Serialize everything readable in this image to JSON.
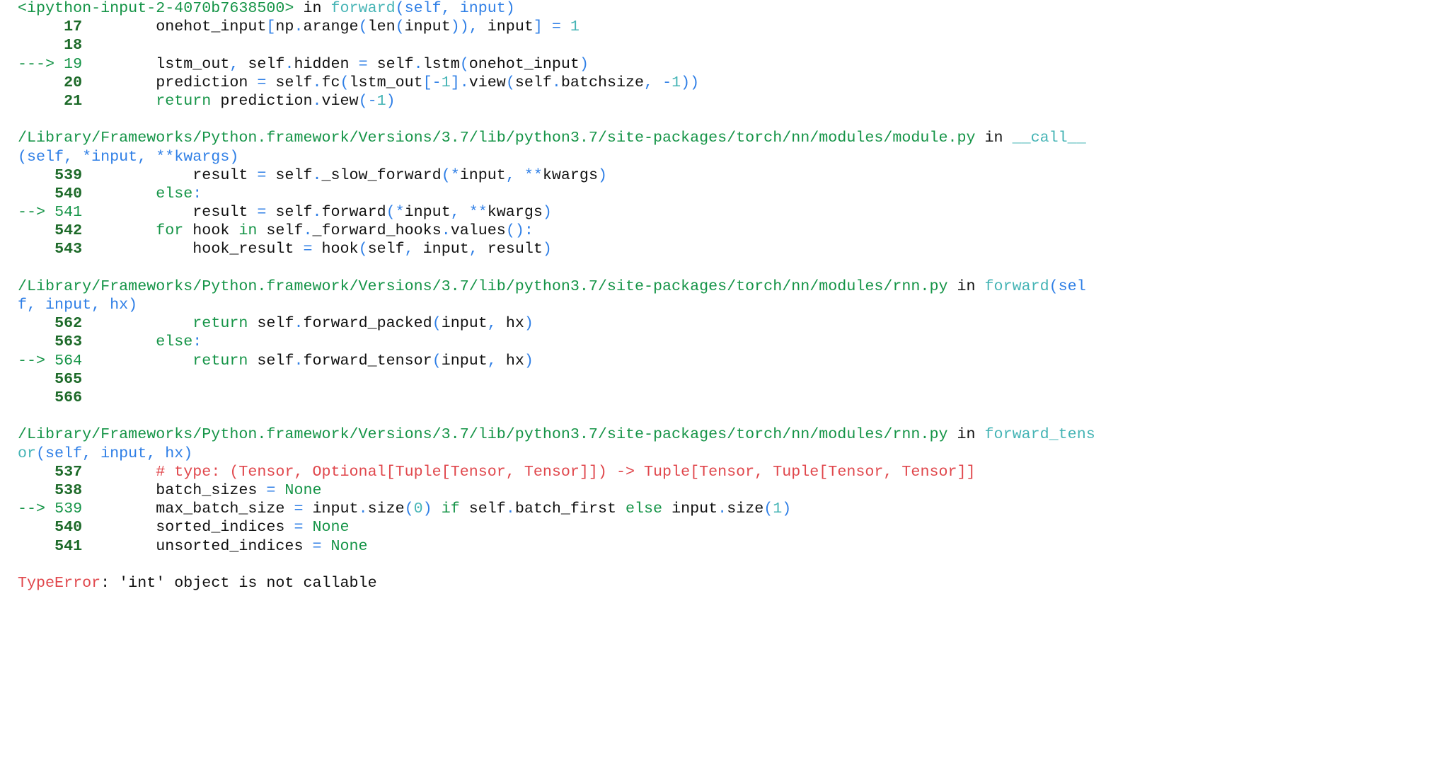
{
  "traceback": {
    "frames": [
      {
        "header": [
          {
            "t": "<ipython-input-2-4070b7638500>",
            "c": "g"
          },
          {
            "t": " in ",
            "c": "k"
          },
          {
            "t": "forward",
            "c": "c"
          },
          {
            "t": "(self, input)",
            "c": "b"
          }
        ],
        "lines": [
          {
            "marker": "",
            "lineno": "17",
            "current": false,
            "tokens": [
              {
                "t": "        onehot_input",
                "c": "k"
              },
              {
                "t": "[",
                "c": "b"
              },
              {
                "t": "np",
                "c": "k"
              },
              {
                "t": ".",
                "c": "b"
              },
              {
                "t": "arange",
                "c": "k"
              },
              {
                "t": "(",
                "c": "b"
              },
              {
                "t": "len",
                "c": "k"
              },
              {
                "t": "(",
                "c": "b"
              },
              {
                "t": "input",
                "c": "k"
              },
              {
                "t": "))",
                "c": "b"
              },
              {
                "t": ",",
                "c": "b"
              },
              {
                "t": " input",
                "c": "k"
              },
              {
                "t": "]",
                "c": "b"
              },
              {
                "t": " = ",
                "c": "b"
              },
              {
                "t": "1",
                "c": "c"
              }
            ]
          },
          {
            "marker": "",
            "lineno": "18",
            "current": false,
            "tokens": []
          },
          {
            "marker": "--->",
            "lineno": "19",
            "current": true,
            "tokens": [
              {
                "t": "        lstm_out",
                "c": "k"
              },
              {
                "t": ",",
                "c": "b"
              },
              {
                "t": " self",
                "c": "k"
              },
              {
                "t": ".",
                "c": "b"
              },
              {
                "t": "hidden ",
                "c": "k"
              },
              {
                "t": "=",
                "c": "b"
              },
              {
                "t": " self",
                "c": "k"
              },
              {
                "t": ".",
                "c": "b"
              },
              {
                "t": "lstm",
                "c": "k"
              },
              {
                "t": "(",
                "c": "b"
              },
              {
                "t": "onehot_input",
                "c": "k"
              },
              {
                "t": ")",
                "c": "b"
              }
            ]
          },
          {
            "marker": "",
            "lineno": "20",
            "current": false,
            "tokens": [
              {
                "t": "        prediction ",
                "c": "k"
              },
              {
                "t": "=",
                "c": "b"
              },
              {
                "t": " self",
                "c": "k"
              },
              {
                "t": ".",
                "c": "b"
              },
              {
                "t": "fc",
                "c": "k"
              },
              {
                "t": "(",
                "c": "b"
              },
              {
                "t": "lstm_out",
                "c": "k"
              },
              {
                "t": "[-",
                "c": "b"
              },
              {
                "t": "1",
                "c": "c"
              },
              {
                "t": "]",
                "c": "b"
              },
              {
                "t": ".",
                "c": "b"
              },
              {
                "t": "view",
                "c": "k"
              },
              {
                "t": "(",
                "c": "b"
              },
              {
                "t": "self",
                "c": "k"
              },
              {
                "t": ".",
                "c": "b"
              },
              {
                "t": "batchsize",
                "c": "k"
              },
              {
                "t": ", -",
                "c": "b"
              },
              {
                "t": "1",
                "c": "c"
              },
              {
                "t": "))",
                "c": "b"
              }
            ]
          },
          {
            "marker": "",
            "lineno": "21",
            "current": false,
            "tokens": [
              {
                "t": "        ",
                "c": "k"
              },
              {
                "t": "return",
                "c": "g"
              },
              {
                "t": " prediction",
                "c": "k"
              },
              {
                "t": ".",
                "c": "b"
              },
              {
                "t": "view",
                "c": "k"
              },
              {
                "t": "(-",
                "c": "b"
              },
              {
                "t": "1",
                "c": "c"
              },
              {
                "t": ")",
                "c": "b"
              }
            ]
          }
        ]
      },
      {
        "header": [
          {
            "t": "/Library/Frameworks/Python.framework/Versions/3.7/lib/python3.7/site-packages/torch/nn/modules/module.py",
            "c": "g"
          },
          {
            "t": " in ",
            "c": "k"
          },
          {
            "t": "__call__",
            "c": "c"
          },
          {
            "t": "\n(self, *input, **kwargs)",
            "c": "b"
          }
        ],
        "lines": [
          {
            "marker": "",
            "lineno": "539",
            "current": false,
            "tokens": [
              {
                "t": "            result ",
                "c": "k"
              },
              {
                "t": "=",
                "c": "b"
              },
              {
                "t": " self",
                "c": "k"
              },
              {
                "t": ".",
                "c": "b"
              },
              {
                "t": "_slow_forward",
                "c": "k"
              },
              {
                "t": "(*",
                "c": "b"
              },
              {
                "t": "input",
                "c": "k"
              },
              {
                "t": ", **",
                "c": "b"
              },
              {
                "t": "kwargs",
                "c": "k"
              },
              {
                "t": ")",
                "c": "b"
              }
            ]
          },
          {
            "marker": "",
            "lineno": "540",
            "current": false,
            "tokens": [
              {
                "t": "        ",
                "c": "k"
              },
              {
                "t": "else",
                "c": "g"
              },
              {
                "t": ":",
                "c": "b"
              }
            ]
          },
          {
            "marker": "-->",
            "lineno": "541",
            "current": true,
            "tokens": [
              {
                "t": "            result ",
                "c": "k"
              },
              {
                "t": "=",
                "c": "b"
              },
              {
                "t": " self",
                "c": "k"
              },
              {
                "t": ".",
                "c": "b"
              },
              {
                "t": "forward",
                "c": "k"
              },
              {
                "t": "(*",
                "c": "b"
              },
              {
                "t": "input",
                "c": "k"
              },
              {
                "t": ", **",
                "c": "b"
              },
              {
                "t": "kwargs",
                "c": "k"
              },
              {
                "t": ")",
                "c": "b"
              }
            ]
          },
          {
            "marker": "",
            "lineno": "542",
            "current": false,
            "tokens": [
              {
                "t": "        ",
                "c": "k"
              },
              {
                "t": "for",
                "c": "g"
              },
              {
                "t": " hook ",
                "c": "k"
              },
              {
                "t": "in",
                "c": "g"
              },
              {
                "t": " self",
                "c": "k"
              },
              {
                "t": ".",
                "c": "b"
              },
              {
                "t": "_forward_hooks",
                "c": "k"
              },
              {
                "t": ".",
                "c": "b"
              },
              {
                "t": "values",
                "c": "k"
              },
              {
                "t": "():",
                "c": "b"
              }
            ]
          },
          {
            "marker": "",
            "lineno": "543",
            "current": false,
            "tokens": [
              {
                "t": "            hook_result ",
                "c": "k"
              },
              {
                "t": "=",
                "c": "b"
              },
              {
                "t": " hook",
                "c": "k"
              },
              {
                "t": "(",
                "c": "b"
              },
              {
                "t": "self",
                "c": "k"
              },
              {
                "t": ",",
                "c": "b"
              },
              {
                "t": " input",
                "c": "k"
              },
              {
                "t": ",",
                "c": "b"
              },
              {
                "t": " result",
                "c": "k"
              },
              {
                "t": ")",
                "c": "b"
              }
            ]
          }
        ]
      },
      {
        "header": [
          {
            "t": "/Library/Frameworks/Python.framework/Versions/3.7/lib/python3.7/site-packages/torch/nn/modules/rnn.py",
            "c": "g"
          },
          {
            "t": " in ",
            "c": "k"
          },
          {
            "t": "forward",
            "c": "c"
          },
          {
            "t": "(sel\nf, input, hx)",
            "c": "b"
          }
        ],
        "lines": [
          {
            "marker": "",
            "lineno": "562",
            "current": false,
            "tokens": [
              {
                "t": "            ",
                "c": "k"
              },
              {
                "t": "return",
                "c": "g"
              },
              {
                "t": " self",
                "c": "k"
              },
              {
                "t": ".",
                "c": "b"
              },
              {
                "t": "forward_packed",
                "c": "k"
              },
              {
                "t": "(",
                "c": "b"
              },
              {
                "t": "input",
                "c": "k"
              },
              {
                "t": ",",
                "c": "b"
              },
              {
                "t": " hx",
                "c": "k"
              },
              {
                "t": ")",
                "c": "b"
              }
            ]
          },
          {
            "marker": "",
            "lineno": "563",
            "current": false,
            "tokens": [
              {
                "t": "        ",
                "c": "k"
              },
              {
                "t": "else",
                "c": "g"
              },
              {
                "t": ":",
                "c": "b"
              }
            ]
          },
          {
            "marker": "-->",
            "lineno": "564",
            "current": true,
            "tokens": [
              {
                "t": "            ",
                "c": "k"
              },
              {
                "t": "return",
                "c": "g"
              },
              {
                "t": " self",
                "c": "k"
              },
              {
                "t": ".",
                "c": "b"
              },
              {
                "t": "forward_tensor",
                "c": "k"
              },
              {
                "t": "(",
                "c": "b"
              },
              {
                "t": "input",
                "c": "k"
              },
              {
                "t": ",",
                "c": "b"
              },
              {
                "t": " hx",
                "c": "k"
              },
              {
                "t": ")",
                "c": "b"
              }
            ]
          },
          {
            "marker": "",
            "lineno": "565",
            "current": false,
            "tokens": []
          },
          {
            "marker": "",
            "lineno": "566",
            "current": false,
            "tokens": []
          }
        ]
      },
      {
        "header": [
          {
            "t": "/Library/Frameworks/Python.framework/Versions/3.7/lib/python3.7/site-packages/torch/nn/modules/rnn.py",
            "c": "g"
          },
          {
            "t": " in ",
            "c": "k"
          },
          {
            "t": "forward_tens\nor",
            "c": "c"
          },
          {
            "t": "(self, input, hx)",
            "c": "b"
          }
        ],
        "lines": [
          {
            "marker": "",
            "lineno": "537",
            "current": false,
            "tokens": [
              {
                "t": "        ",
                "c": "k"
              },
              {
                "t": "# type: (Tensor, Optional[Tuple[Tensor, Tensor]]) -> Tuple[Tensor, Tuple[Tensor, Tensor]]",
                "c": "r"
              }
            ]
          },
          {
            "marker": "",
            "lineno": "538",
            "current": false,
            "tokens": [
              {
                "t": "        batch_sizes ",
                "c": "k"
              },
              {
                "t": "=",
                "c": "b"
              },
              {
                "t": " None",
                "c": "g"
              }
            ]
          },
          {
            "marker": "-->",
            "lineno": "539",
            "current": true,
            "tokens": [
              {
                "t": "        max_batch_size ",
                "c": "k"
              },
              {
                "t": "=",
                "c": "b"
              },
              {
                "t": " input",
                "c": "k"
              },
              {
                "t": ".",
                "c": "b"
              },
              {
                "t": "size",
                "c": "k"
              },
              {
                "t": "(",
                "c": "b"
              },
              {
                "t": "0",
                "c": "c"
              },
              {
                "t": ")",
                "c": "b"
              },
              {
                "t": " ",
                "c": "k"
              },
              {
                "t": "if",
                "c": "g"
              },
              {
                "t": " self",
                "c": "k"
              },
              {
                "t": ".",
                "c": "b"
              },
              {
                "t": "batch_first ",
                "c": "k"
              },
              {
                "t": "else",
                "c": "g"
              },
              {
                "t": " input",
                "c": "k"
              },
              {
                "t": ".",
                "c": "b"
              },
              {
                "t": "size",
                "c": "k"
              },
              {
                "t": "(",
                "c": "b"
              },
              {
                "t": "1",
                "c": "c"
              },
              {
                "t": ")",
                "c": "b"
              }
            ]
          },
          {
            "marker": "",
            "lineno": "540",
            "current": false,
            "tokens": [
              {
                "t": "        sorted_indices ",
                "c": "k"
              },
              {
                "t": "=",
                "c": "b"
              },
              {
                "t": " None",
                "c": "g"
              }
            ]
          },
          {
            "marker": "",
            "lineno": "541",
            "current": false,
            "tokens": [
              {
                "t": "        unsorted_indices ",
                "c": "k"
              },
              {
                "t": "=",
                "c": "b"
              },
              {
                "t": " None",
                "c": "g"
              }
            ]
          }
        ]
      }
    ],
    "error": {
      "type": "TypeError",
      "message": ": 'int' object is not callable"
    }
  },
  "colors": {
    "green": "#159447",
    "lineno_green": "#1d6a29",
    "cyan": "#45b4b5",
    "blue": "#2f7fe6",
    "red": "#e0474c",
    "text": "#111111"
  }
}
